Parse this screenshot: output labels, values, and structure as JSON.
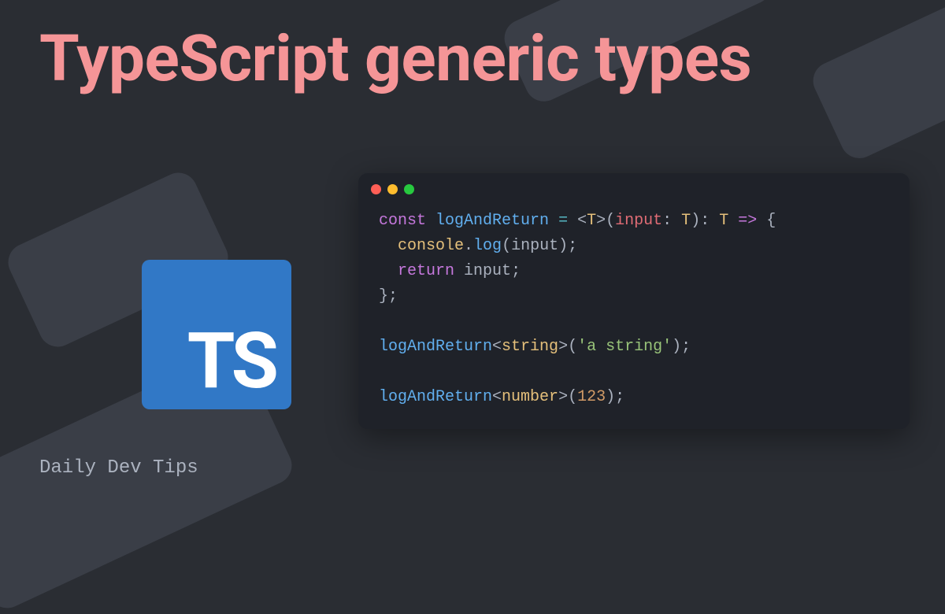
{
  "title": "TypeScript generic types",
  "logo": {
    "text": "TS"
  },
  "code": {
    "tokens": [
      [
        {
          "t": "const ",
          "c": "tk-keyword"
        },
        {
          "t": "logAndReturn",
          "c": "tk-func"
        },
        {
          "t": " ",
          "c": "tk-punct"
        },
        {
          "t": "=",
          "c": "tk-op"
        },
        {
          "t": " ",
          "c": "tk-punct"
        },
        {
          "t": "<",
          "c": "tk-punct"
        },
        {
          "t": "T",
          "c": "tk-type"
        },
        {
          "t": ">(",
          "c": "tk-punct"
        },
        {
          "t": "input",
          "c": "tk-param"
        },
        {
          "t": ": ",
          "c": "tk-punct"
        },
        {
          "t": "T",
          "c": "tk-type"
        },
        {
          "t": "): ",
          "c": "tk-punct"
        },
        {
          "t": "T",
          "c": "tk-type"
        },
        {
          "t": " ",
          "c": "tk-punct"
        },
        {
          "t": "=>",
          "c": "tk-keyword"
        },
        {
          "t": " {",
          "c": "tk-punct"
        }
      ],
      [
        {
          "t": "  ",
          "c": "tk-punct"
        },
        {
          "t": "console",
          "c": "tk-console"
        },
        {
          "t": ".",
          "c": "tk-punct"
        },
        {
          "t": "log",
          "c": "tk-func"
        },
        {
          "t": "(",
          "c": "tk-punct"
        },
        {
          "t": "input",
          "c": "tk-prop"
        },
        {
          "t": ");",
          "c": "tk-punct"
        }
      ],
      [
        {
          "t": "  ",
          "c": "tk-punct"
        },
        {
          "t": "return",
          "c": "tk-keyword"
        },
        {
          "t": " ",
          "c": "tk-punct"
        },
        {
          "t": "input",
          "c": "tk-prop"
        },
        {
          "t": ";",
          "c": "tk-punct"
        }
      ],
      [
        {
          "t": "};",
          "c": "tk-punct"
        }
      ],
      [],
      [
        {
          "t": "logAndReturn",
          "c": "tk-func"
        },
        {
          "t": "<",
          "c": "tk-punct"
        },
        {
          "t": "string",
          "c": "tk-type"
        },
        {
          "t": ">(",
          "c": "tk-punct"
        },
        {
          "t": "'a string'",
          "c": "tk-string"
        },
        {
          "t": ");",
          "c": "tk-punct"
        }
      ],
      [],
      [
        {
          "t": "logAndReturn",
          "c": "tk-func"
        },
        {
          "t": "<",
          "c": "tk-punct"
        },
        {
          "t": "number",
          "c": "tk-type"
        },
        {
          "t": ">(",
          "c": "tk-punct"
        },
        {
          "t": "123",
          "c": "tk-number"
        },
        {
          "t": ");",
          "c": "tk-punct"
        }
      ]
    ]
  },
  "footer": "Daily Dev Tips"
}
